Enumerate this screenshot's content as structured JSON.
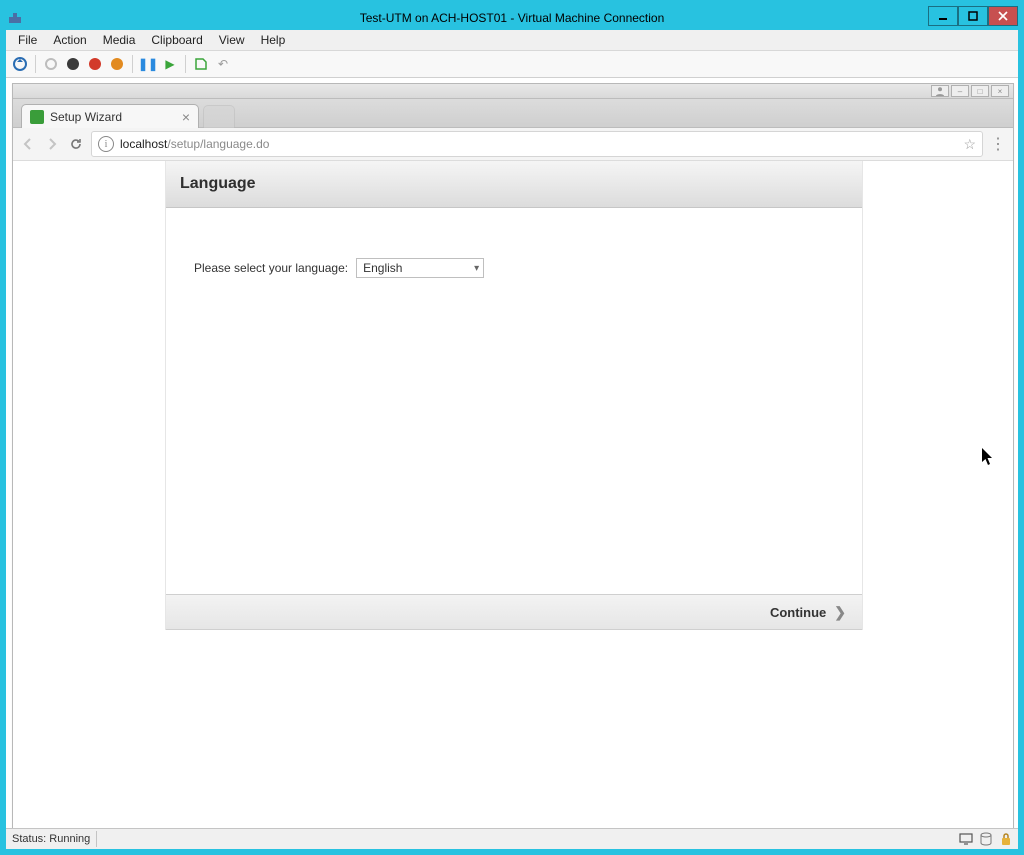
{
  "window": {
    "title": "Test-UTM on ACH-HOST01 - Virtual Machine Connection"
  },
  "menubar": {
    "items": [
      "File",
      "Action",
      "Media",
      "Clipboard",
      "View",
      "Help"
    ]
  },
  "statusbar": {
    "label": "Status: Running"
  },
  "browser": {
    "tab_title": "Setup Wizard",
    "url_host": "localhost",
    "url_path": "/setup/language.do"
  },
  "wizard": {
    "header": "Language",
    "prompt": "Please select your language:",
    "language_selected": "English",
    "continue_label": "Continue"
  }
}
